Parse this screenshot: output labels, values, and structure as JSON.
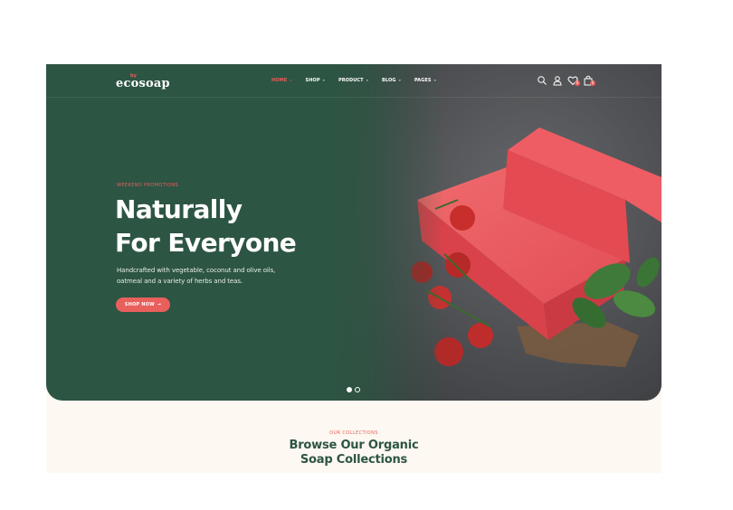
{
  "brand": {
    "logo_small": "by",
    "logo_text": "ecosoap"
  },
  "nav": {
    "items": [
      {
        "label": "HOME",
        "active": true
      },
      {
        "label": "SHOP",
        "active": false
      },
      {
        "label": "PRODUCT",
        "active": false
      },
      {
        "label": "BLOG",
        "active": false
      },
      {
        "label": "PAGES",
        "active": false
      }
    ],
    "caret": "⌄"
  },
  "header_icons": [
    {
      "name": "search-icon"
    },
    {
      "name": "user-icon"
    },
    {
      "name": "wishlist-icon",
      "badge": "0"
    },
    {
      "name": "cart-icon",
      "badge": "0"
    }
  ],
  "hero": {
    "promo": "WEEKEND PROMOTIONS",
    "headline_line1": "Naturally",
    "headline_line2": "For Everyone",
    "description": "Handcrafted with vegetable, coconut and olive oils, oatmeal and a variety of herbs and teas.",
    "cta_label": "SHOP NOW",
    "cta_arrow": "→",
    "slides": 2,
    "active_slide": 1
  },
  "collections": {
    "kicker": "OUR COLLECTIONS",
    "title_line1": "Browse Our Organic",
    "title_line2": "Soap Collections"
  },
  "colors": {
    "primary_green": "#2d5543",
    "accent_coral": "#e85f5c",
    "cream_bg": "#fdf8f1",
    "soap_red": "#e8545a"
  }
}
